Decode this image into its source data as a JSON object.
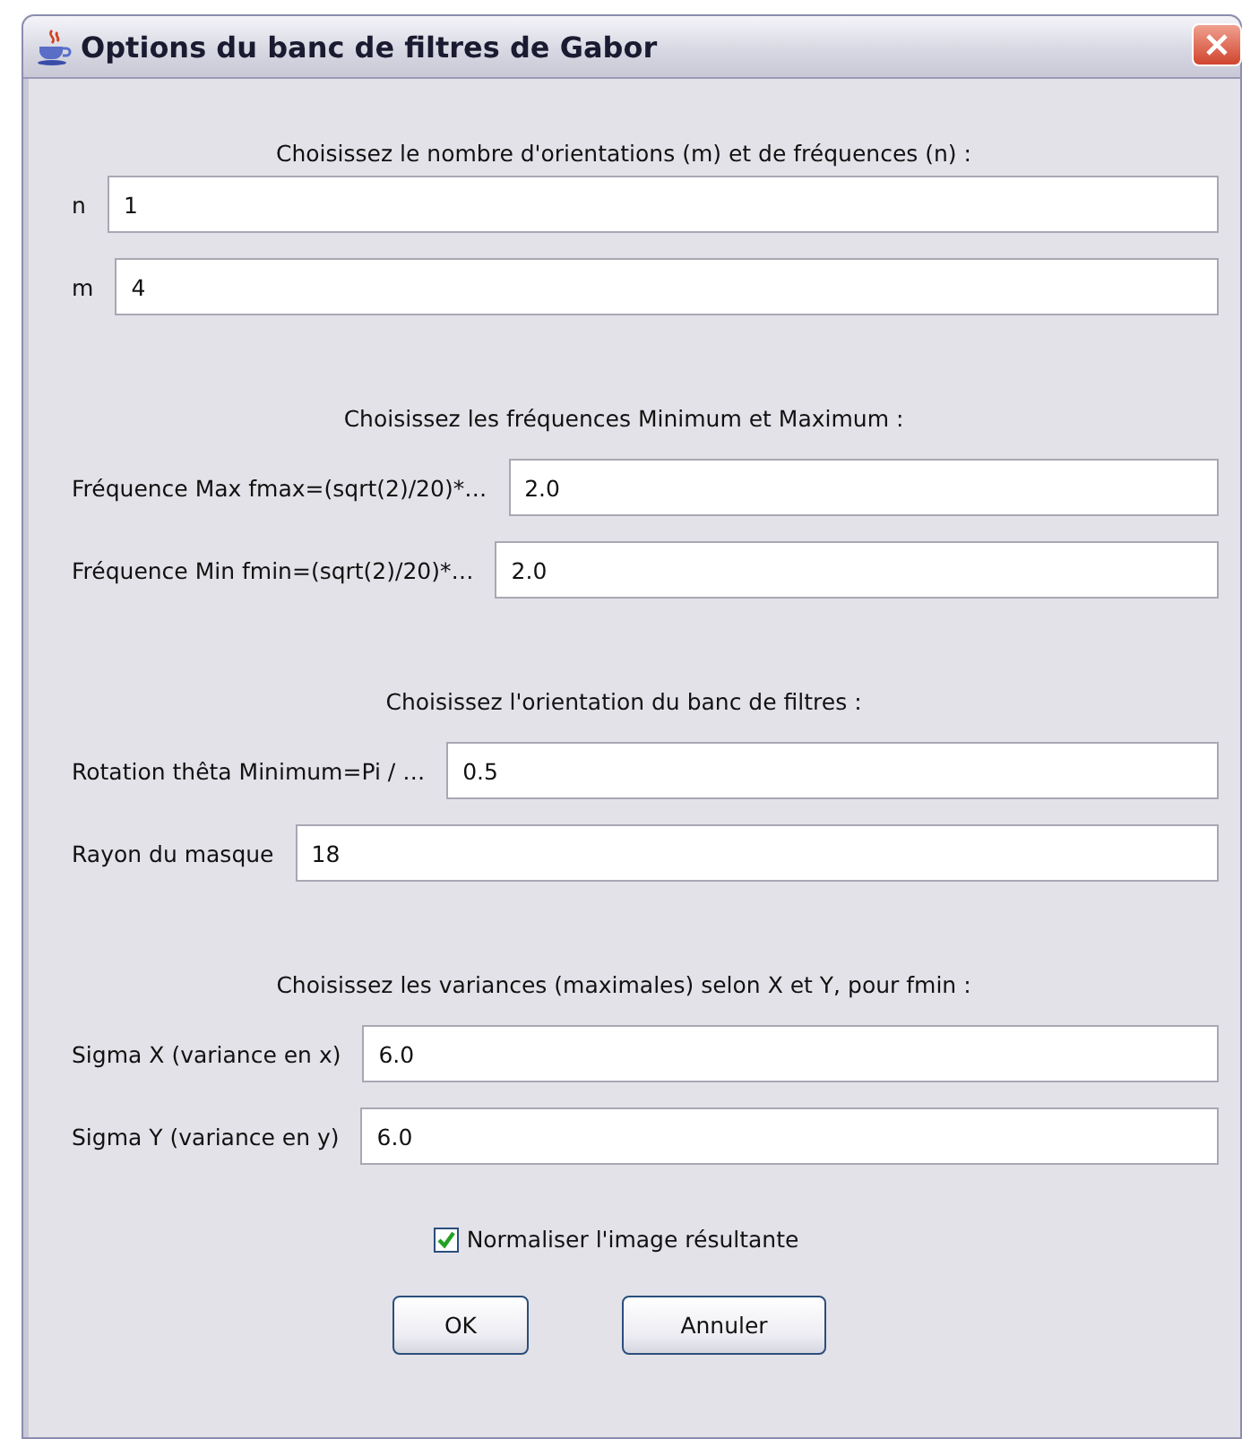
{
  "window": {
    "title": "Options du banc de filtres de Gabor"
  },
  "items": [
    {
      "kind": "heading",
      "text": "Choisissez le nombre d'orientations (m) et de fréquences (n) :"
    },
    {
      "kind": "field",
      "label": "n",
      "value": "1"
    },
    {
      "kind": "field",
      "label": "m",
      "value": "4"
    },
    {
      "kind": "heading",
      "text": "Choisissez les fréquences Minimum et Maximum :"
    },
    {
      "kind": "field",
      "label": "Fréquence Max fmax=(sqrt(2)/20)*…",
      "value": "2.0"
    },
    {
      "kind": "field",
      "label": "Fréquence Min fmin=(sqrt(2)/20)*…",
      "value": "2.0"
    },
    {
      "kind": "heading",
      "text": "Choisissez l'orientation du banc de filtres :"
    },
    {
      "kind": "field",
      "label": "Rotation thêta Minimum=Pi / …",
      "value": "0.5"
    },
    {
      "kind": "field",
      "label": "Rayon du masque",
      "value": "18"
    },
    {
      "kind": "heading",
      "text": "Choisissez les variances (maximales) selon X et Y, pour fmin :"
    },
    {
      "kind": "field",
      "label": "Sigma X (variance en x)",
      "value": "6.0"
    },
    {
      "kind": "field",
      "label": "Sigma Y (variance en y)",
      "value": "6.0"
    },
    {
      "kind": "checkbox",
      "label": "Normaliser l'image résultante",
      "checked": true
    }
  ],
  "buttons": [
    "OK",
    "Annuler"
  ]
}
